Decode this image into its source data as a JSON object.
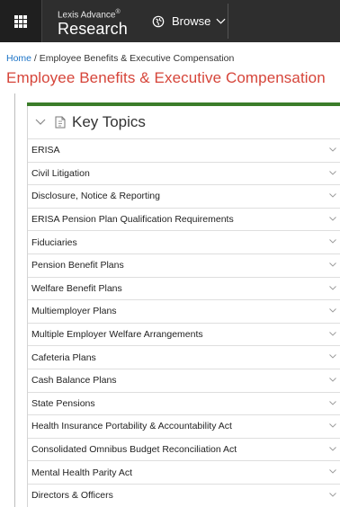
{
  "header": {
    "brand_prefix": "Lexis Advance",
    "brand_reg": "®",
    "brand_main": "Research",
    "browse_label": "Browse",
    "bg_color": "#2e2e2e"
  },
  "breadcrumb": {
    "home": "Home",
    "separator": " / ",
    "current": "Employee Benefits & Executive Compensation"
  },
  "page_title": "Employee Benefits & Executive Compensation",
  "panel": {
    "title": "Key Topics",
    "accent_color": "#3b7d2a",
    "topics": [
      "ERISA",
      "Civil Litigation",
      "Disclosure, Notice & Reporting",
      "ERISA Pension Plan Qualification Requirements",
      "Fiduciaries",
      "Pension Benefit Plans",
      "Welfare Benefit Plans",
      "Multiemployer Plans",
      "Multiple Employer Welfare Arrangements",
      "Cafeteria Plans",
      "Cash Balance Plans",
      "State Pensions",
      "Health Insurance Portability & Accountability Act",
      "Consolidated Omnibus Budget Reconciliation Act",
      "Mental Health Parity Act",
      "Directors & Officers"
    ]
  },
  "title_color": "#d6453a",
  "link_color": "#1a73c7"
}
